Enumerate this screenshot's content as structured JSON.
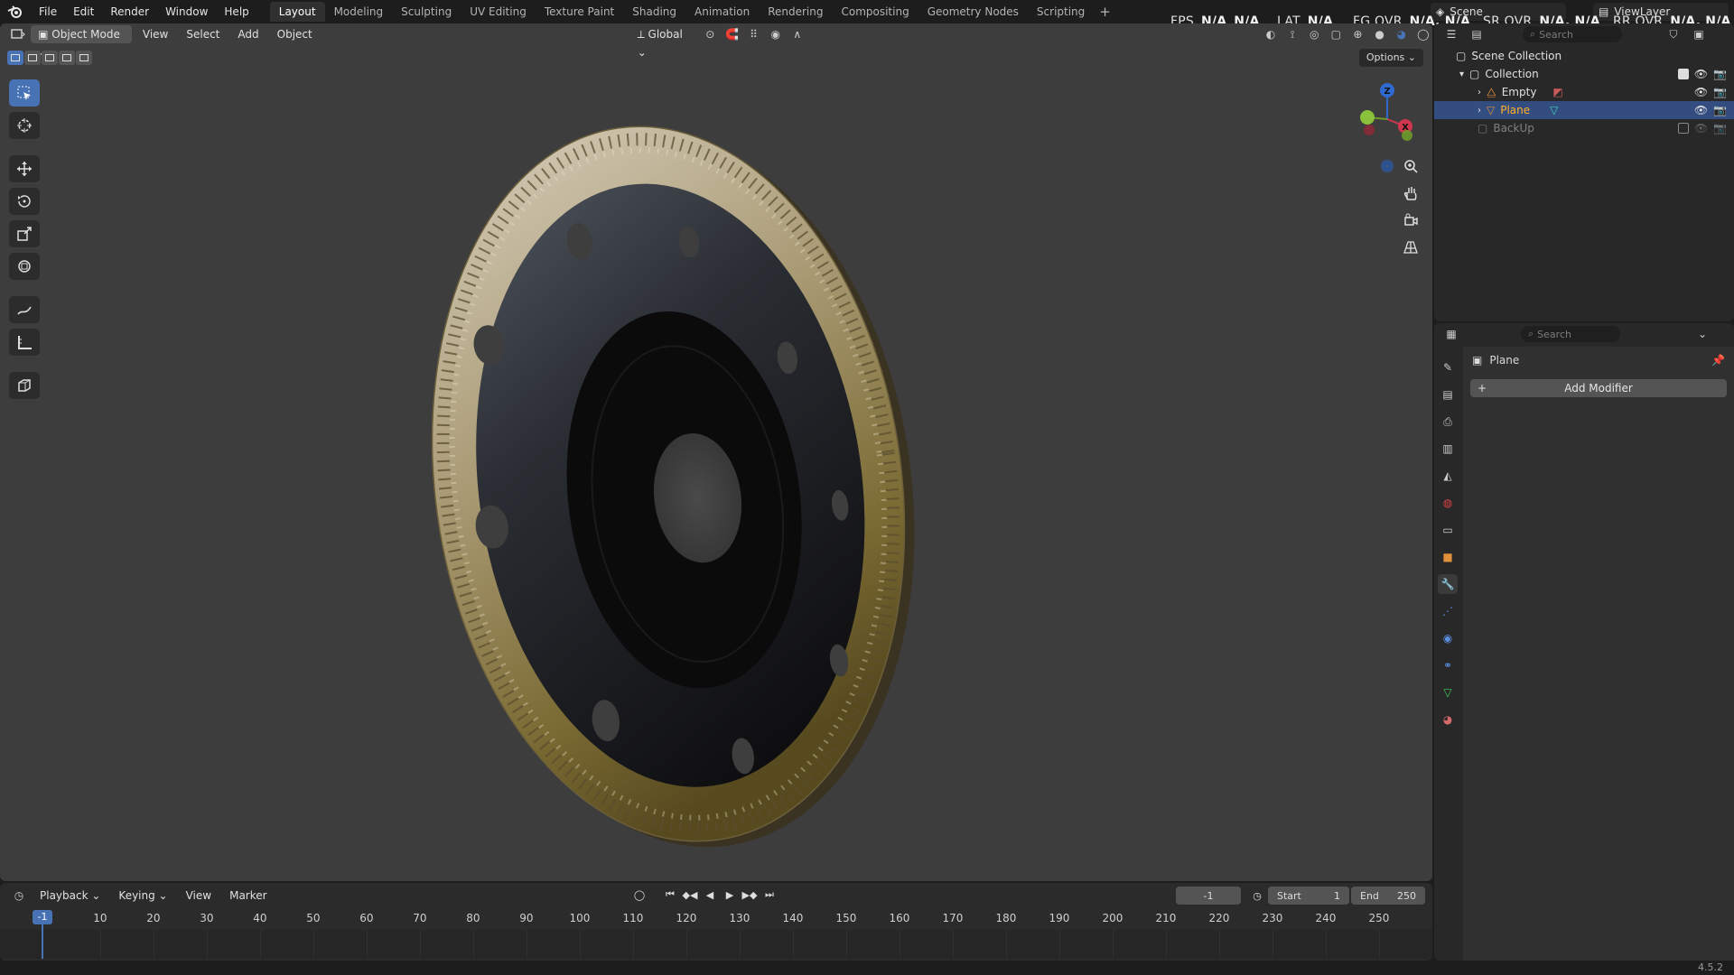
{
  "menubar": {
    "items": [
      "File",
      "Edit",
      "Render",
      "Window",
      "Help"
    ],
    "workspaces": [
      "Layout",
      "Modeling",
      "Sculpting",
      "UV Editing",
      "Texture Paint",
      "Shading",
      "Animation",
      "Rendering",
      "Compositing",
      "Geometry Nodes",
      "Scripting"
    ],
    "active_workspace": "Layout",
    "add_tab": "+"
  },
  "stats": {
    "fps_label": "FPS",
    "fps_value": "N/A",
    "fps_value2": "N/A",
    "lat_label": "LAT",
    "lat_value": "N/A",
    "fg_label": "FG OVR",
    "fg_value": "N/A, N/A",
    "sr_label": "SR OVR",
    "sr_value": "N/A, N/A",
    "rr_label": "RR OVR",
    "rr_value": "N/A, N/A"
  },
  "scene": {
    "name": "Scene",
    "view_layer": "ViewLayer"
  },
  "viewport": {
    "mode": "Object Mode",
    "menus": [
      "View",
      "Select",
      "Add",
      "Object"
    ],
    "transform_orientation": "Global",
    "options_label": "Options"
  },
  "gizmo": {
    "z": "Z",
    "x": "X",
    "y": "Y"
  },
  "outliner": {
    "search_placeholder": "Search",
    "scene_collection": "Scene Collection",
    "collection": "Collection",
    "items": [
      {
        "name": "Empty"
      },
      {
        "name": "Plane"
      },
      {
        "name": "BackUp"
      }
    ]
  },
  "properties": {
    "search_placeholder": "Search",
    "object_name": "Plane",
    "add_modifier": "Add Modifier",
    "add_icon": "+"
  },
  "timeline": {
    "menus": [
      "Playback",
      "Keying",
      "View",
      "Marker"
    ],
    "current_frame": "-1",
    "current_frame_field": "-1",
    "start_label": "Start",
    "start_value": "1",
    "end_label": "End",
    "end_value": "250",
    "ticks": [
      "10",
      "20",
      "30",
      "40",
      "50",
      "60",
      "70",
      "80",
      "90",
      "100",
      "110",
      "120",
      "130",
      "140",
      "150",
      "160",
      "170",
      "180",
      "190",
      "200",
      "210",
      "220",
      "230",
      "240",
      "250"
    ]
  },
  "status": {
    "version": "4.5.2"
  },
  "colors": {
    "accent": "#4772b3",
    "selected_object": "#ffaf29",
    "viewport_bg": "#3d3d3d"
  }
}
